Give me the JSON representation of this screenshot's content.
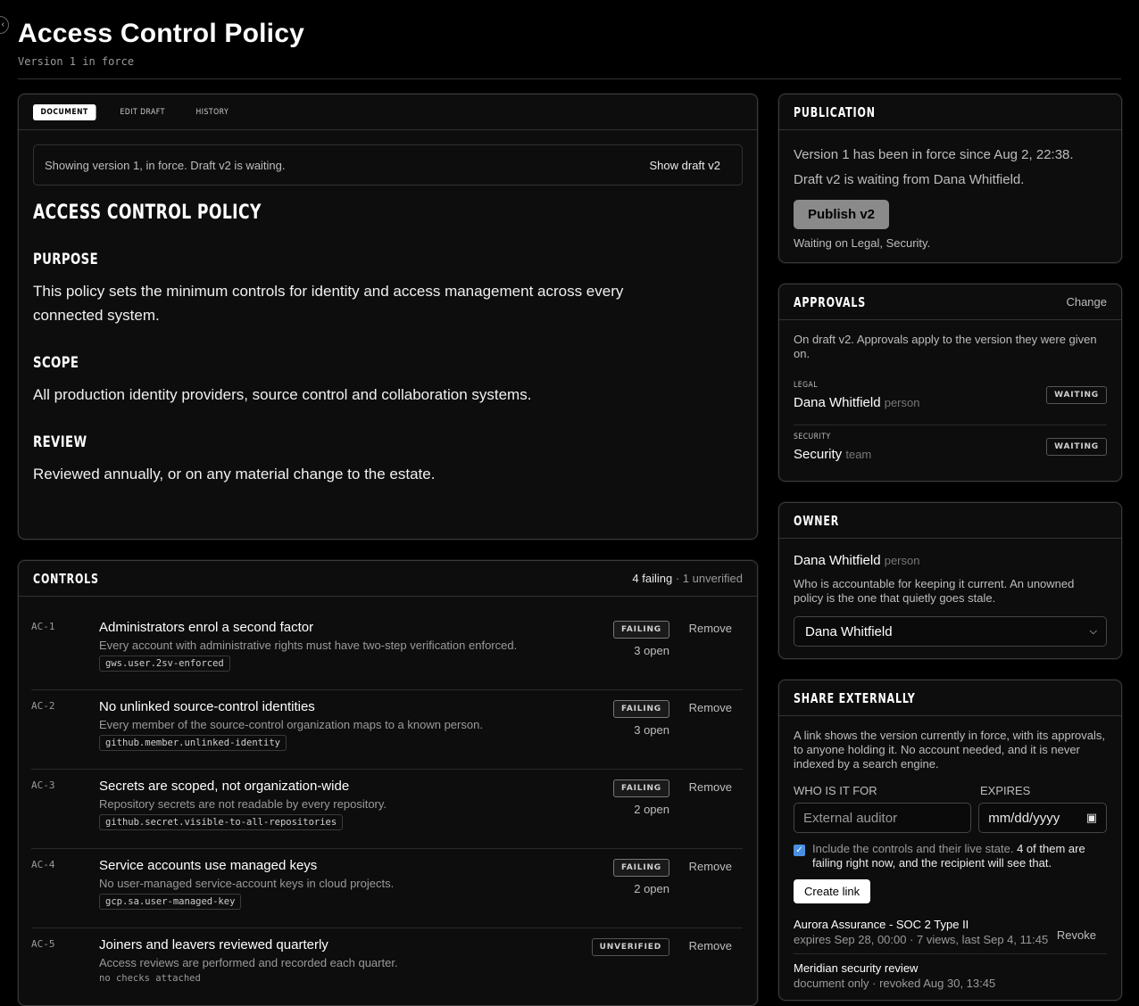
{
  "header": {
    "title": "Access Control Policy",
    "subtitle": "Version 1 in force"
  },
  "tabs": [
    "DOCUMENT",
    "EDIT DRAFT",
    "HISTORY"
  ],
  "notice": {
    "text": "Showing version 1, in force. Draft v2 is waiting.",
    "button": "Show draft v2"
  },
  "document": {
    "title": "ACCESS CONTROL POLICY",
    "sections": [
      {
        "heading": "PURPOSE",
        "body": "This policy sets the minimum controls for identity and access management across every connected system."
      },
      {
        "heading": "SCOPE",
        "body": "All production identity providers, source control and collaboration systems."
      },
      {
        "heading": "REVIEW",
        "body": "Reviewed annually, or on any material change to the estate."
      }
    ]
  },
  "controls": {
    "title": "CONTROLS",
    "summary_failing": "4 failing",
    "summary_rest": " · 1 unverified",
    "remove_label": "Remove",
    "items": [
      {
        "id": "AC-1",
        "title": "Administrators enrol a second factor",
        "desc": "Every account with administrative rights must have two-step verification enforced.",
        "check": "gws.user.2sv-enforced",
        "status": "FAILING",
        "open": "3 open"
      },
      {
        "id": "AC-2",
        "title": "No unlinked source-control identities",
        "desc": "Every member of the source-control organization maps to a known person.",
        "check": "github.member.unlinked-identity",
        "status": "FAILING",
        "open": "3 open"
      },
      {
        "id": "AC-3",
        "title": "Secrets are scoped, not organization-wide",
        "desc": "Repository secrets are not readable by every repository.",
        "check": "github.secret.visible-to-all-repositories",
        "status": "FAILING",
        "open": "2 open"
      },
      {
        "id": "AC-4",
        "title": "Service accounts use managed keys",
        "desc": "No user-managed service-account keys in cloud projects.",
        "check": "gcp.sa.user-managed-key",
        "status": "FAILING",
        "open": "2 open"
      },
      {
        "id": "AC-5",
        "title": "Joiners and leavers reviewed quarterly",
        "desc": "Access reviews are performed and recorded each quarter.",
        "check": "no checks attached",
        "status": "UNVERIFIED",
        "open": ""
      }
    ]
  },
  "publication": {
    "title": "PUBLICATION",
    "line1": "Version 1 has been in force since Aug 2, 22:38.",
    "line2": "Draft v2 is waiting from Dana Whitfield.",
    "button": "Publish v2",
    "waiting": "Waiting on Legal, Security."
  },
  "approvals": {
    "title": "APPROVALS",
    "change": "Change",
    "note": "On draft v2. Approvals apply to the version they were given on.",
    "items": [
      {
        "role": "LEGAL",
        "name": "Dana Whitfield",
        "type": "person",
        "status": "WAITING"
      },
      {
        "role": "SECURITY",
        "name": "Security",
        "type": "team",
        "status": "WAITING"
      }
    ]
  },
  "owner": {
    "title": "OWNER",
    "name": "Dana Whitfield",
    "type": "person",
    "note": "Who is accountable for keeping it current. An unowned policy is the one that quietly goes stale.",
    "selected": "Dana Whitfield"
  },
  "share": {
    "title": "SHARE EXTERNALLY",
    "note": "A link shows the version currently in force, with its approvals, to anyone holding it. No account needed, and it is never indexed by a search engine.",
    "who_label": "WHO IS IT FOR",
    "who_placeholder": "External auditor",
    "expires_label": "EXPIRES",
    "expires_placeholder": "mm/dd/yyyy",
    "include_label": "Include the controls and their live state.",
    "include_warning": " 4 of them are failing right now, and the recipient will see that.",
    "create_button": "Create link",
    "links": [
      {
        "name": "Aurora Assurance - SOC 2 Type II",
        "meta": "expires Sep 28, 00:00 · 7 views, last Sep 4, 11:45",
        "action": "Revoke"
      },
      {
        "name": "Meridian security review",
        "meta": "document only · revoked Aug 30, 13:45",
        "action": ""
      }
    ]
  }
}
